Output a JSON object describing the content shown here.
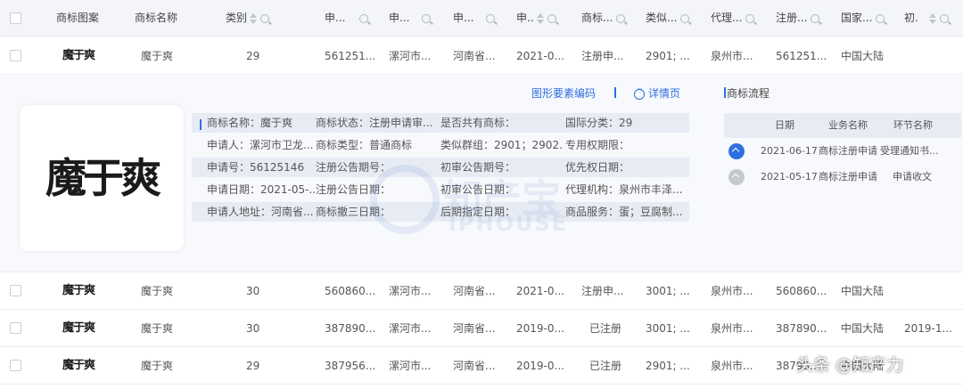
{
  "header": {
    "logo": "商标图案",
    "name": "商标名称",
    "category": "类别",
    "regno": "申...",
    "applicant": "申...",
    "address": "申...",
    "appdate": "申..",
    "status": "商标...",
    "similar": "类似...",
    "agent": "代理...",
    "regnum": "注册...",
    "country": "国家...",
    "initial": "初."
  },
  "rows": [
    {
      "logo": "魔于爽",
      "name": "魔于爽",
      "category": "29",
      "regno": "561251...",
      "applicant": "漯河市...",
      "address": "河南省...",
      "appdate": "2021-0...",
      "status": "注册申...",
      "similar": "2901; ...",
      "agent": "泉州市...",
      "regnum": "561251...",
      "country": "中国大陆",
      "initial": ""
    },
    {
      "logo": "魔于爽",
      "name": "魔于爽",
      "category": "30",
      "regno": "560860...",
      "applicant": "漯河市...",
      "address": "河南省...",
      "appdate": "2021-0...",
      "status": "注册申...",
      "similar": "3001; ...",
      "agent": "泉州市...",
      "regnum": "560860...",
      "country": "中国大陆",
      "initial": ""
    },
    {
      "logo": "魔于爽",
      "name": "魔于爽",
      "category": "30",
      "regno": "387890...",
      "applicant": "漯河市...",
      "address": "河南省...",
      "appdate": "2019-0...",
      "status": "已注册",
      "similar": "3001; ...",
      "agent": "泉州市...",
      "regnum": "387890...",
      "country": "中国大陆",
      "initial": "2019-1..."
    },
    {
      "logo": "魔于爽",
      "name": "魔于爽",
      "category": "29",
      "regno": "387956...",
      "applicant": "漯河市...",
      "address": "河南省...",
      "appdate": "2019-0...",
      "status": "已注册",
      "similar": "2901; ...",
      "agent": "泉州市...",
      "regnum": "38795...",
      "country": "中国大陆",
      "initial": ""
    }
  ],
  "detail": {
    "logo_text": "魔于爽",
    "tab_code": "图形要素编码",
    "tab_detail": "详情页",
    "info": [
      [
        "商标名称：魔于爽",
        "商标状态：注册申请审...",
        "是否共有商标：",
        "国际分类：29"
      ],
      [
        "申请人：漯河市卫龙...",
        "商标类型：普通商标",
        "类似群组：2901；2902...",
        "专用权期限："
      ],
      [
        "申请号：56125146",
        "注册公告期号：",
        "初审公告期号：",
        "优先权日期："
      ],
      [
        "申请日期：2021-05-...",
        "注册公告日期：",
        "初审公告日期：",
        "代理机构：泉州市丰泽..."
      ],
      [
        "申请人地址：河南省...",
        "商标撤三日期：",
        "后期指定日期：",
        "商品服务：蛋；豆腐制..."
      ]
    ],
    "watermark_text": "知产宝",
    "watermark_sub": "IPHOUSE",
    "flow": {
      "title": "商标流程",
      "headers": [
        "日期",
        "业务名称",
        "环节名称"
      ],
      "items": [
        {
          "date": "2021-06-17",
          "business": "商标注册申请",
          "step": "受理通知书...",
          "color": "#2f6fdf"
        },
        {
          "date": "2021-05-17",
          "business": "商标注册申请",
          "step": "申请收文",
          "color": "#c5c8cd"
        }
      ]
    }
  },
  "footer_watermark": "头条 @知产力"
}
